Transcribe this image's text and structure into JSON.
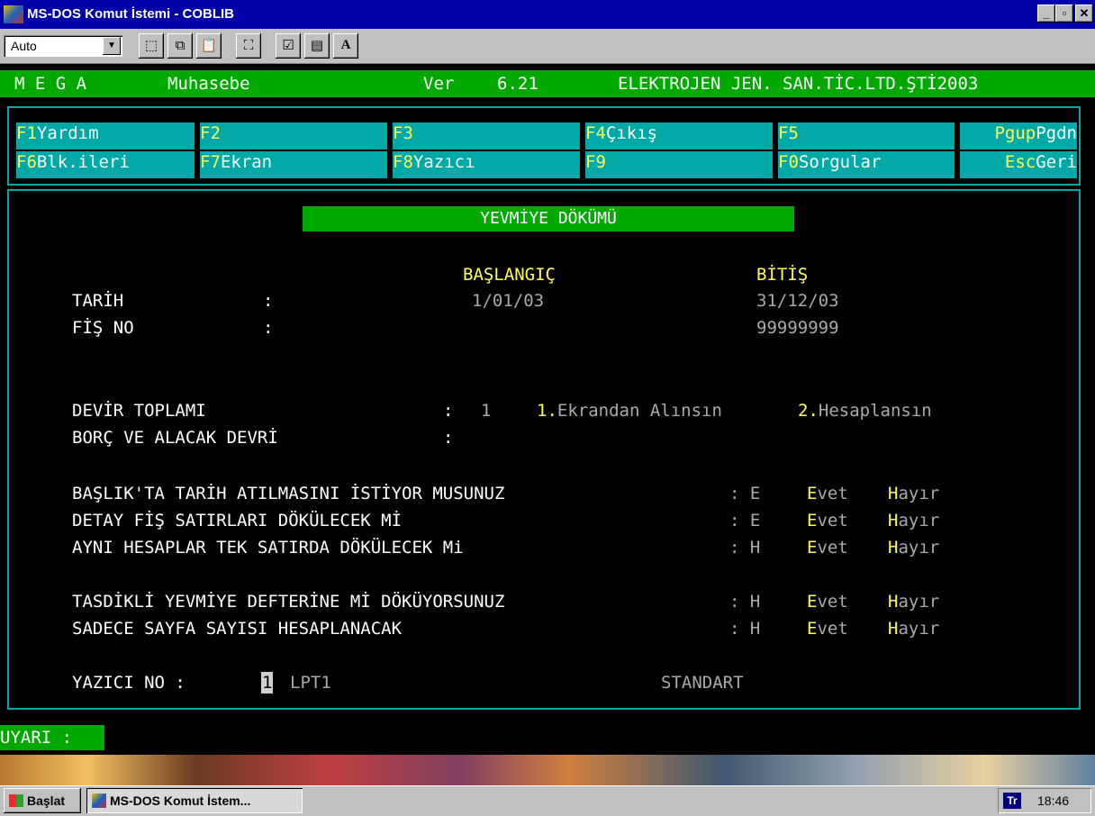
{
  "window": {
    "title": "MS-DOS Komut İstemi - COBLIB",
    "minimize": "_",
    "maximize": "▫",
    "close": "✕"
  },
  "toolbar": {
    "font_value": "Auto",
    "font_btn": "A"
  },
  "header": {
    "app": "M E G A",
    "module": "Muhasebe",
    "version_label": "Ver",
    "version": "6.21",
    "company": "ELEKTROJEN JEN. SAN.TİC.LTD.ŞTİ2003"
  },
  "menu": {
    "row1": [
      {
        "key": "F1",
        "label": "Yardım"
      },
      {
        "key": "F2",
        "label": ""
      },
      {
        "key": "F3",
        "label": ""
      },
      {
        "key": "F4",
        "label": "Çıkış"
      },
      {
        "key": "F5",
        "label": ""
      },
      {
        "key": "Pgup",
        "label": "Pgdn"
      }
    ],
    "row2": [
      {
        "key": "F6",
        "label": "Blk.ileri"
      },
      {
        "key": "F7",
        "label": "Ekran"
      },
      {
        "key": "F8",
        "label": "Yazıcı"
      },
      {
        "key": "F9",
        "label": ""
      },
      {
        "key": "F0",
        "label": "Sorgular"
      },
      {
        "key": "Esc",
        "label": "Geri"
      }
    ]
  },
  "form": {
    "heading": "YEVMİYE DÖKÜMÜ",
    "col_start": "BAŞLANGIÇ",
    "col_end": "BİTİŞ",
    "tarih_label": "TARİH",
    "tarih_start": "1/01/03",
    "tarih_end": "31/12/03",
    "fis_label": "FİŞ NO",
    "fis_end": "99999999",
    "colon": ":",
    "devir_label": "DEVİR TOPLAMI",
    "devir_value": "1",
    "opt1_num": "1.",
    "opt1_text": "Ekrandan Alınsın",
    "opt2_num": "2.",
    "opt2_text": "Hesaplansın",
    "borc_label": "BORÇ VE ALACAK DEVRİ",
    "questions": [
      {
        "label": "BAŞLIK'TA TARİH ATILMASINI İSTİYOR MUSUNUZ",
        "value": "E"
      },
      {
        "label": "DETAY FİŞ SATIRLARI DÖKÜLECEK Mİ",
        "value": "E"
      },
      {
        "label": "AYNI HESAPLAR TEK SATIRDA DÖKÜLECEK Mi",
        "value": "H"
      },
      {
        "label": "TASDİKLİ YEVMİYE DEFTERİNE Mİ DÖKÜYORSUNUZ",
        "value": "H"
      },
      {
        "label": "SADECE SAYFA SAYISI HESAPLANACAK",
        "value": "H"
      }
    ],
    "evet_key": "E",
    "evet_rest": "vet",
    "hayir_key": "H",
    "hayir_rest": "ayır",
    "printer_label": "YAZICI NO :",
    "printer_no": "1",
    "printer_port": "LPT1",
    "printer_type": "STANDART"
  },
  "status": {
    "warning_label": "UYARI :"
  },
  "taskbar": {
    "start": "Başlat",
    "task": "MS-DOS Komut İstem...",
    "lang": "Tr",
    "clock": "18:46"
  }
}
